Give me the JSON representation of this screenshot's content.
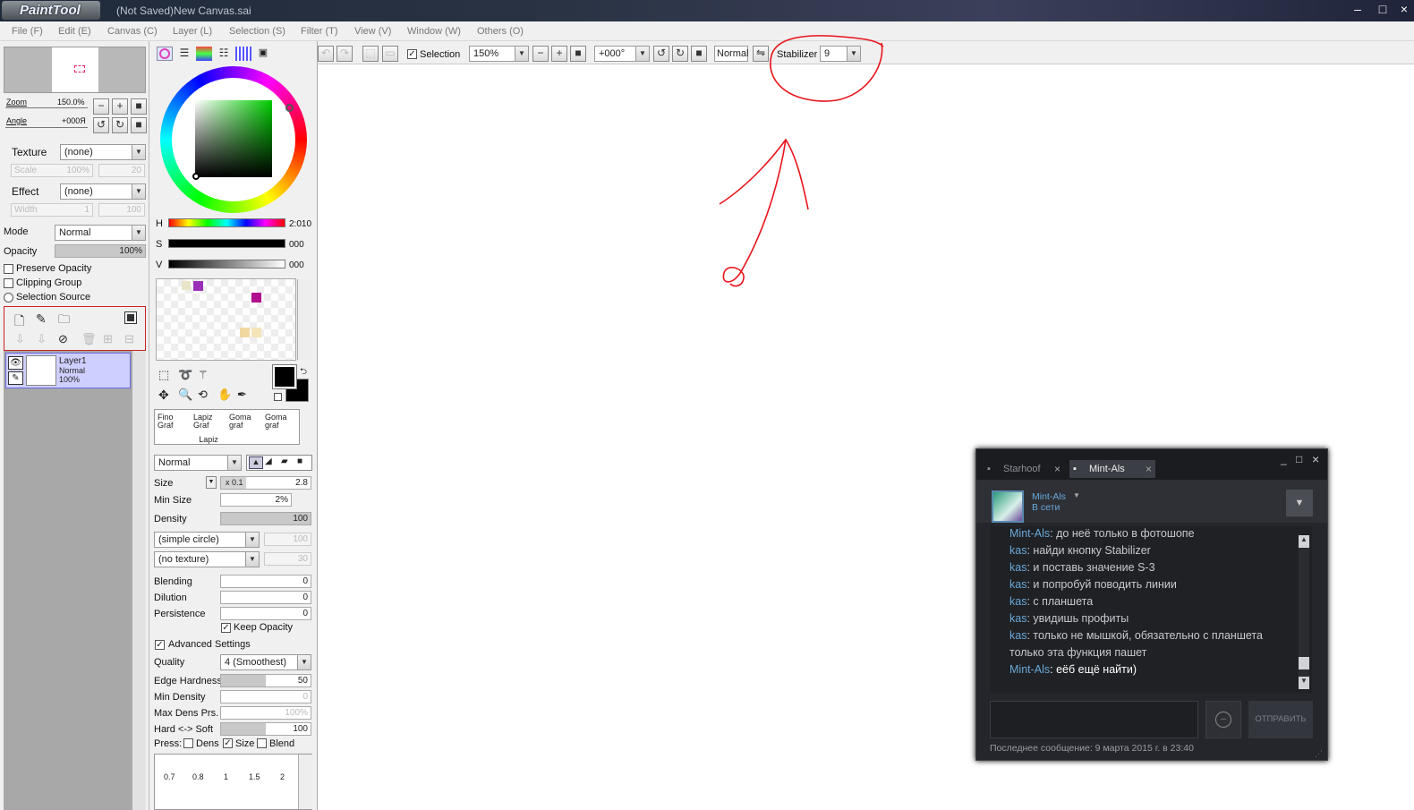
{
  "window": {
    "app_name": "PaintTool SAI",
    "title": "(Not Saved)New Canvas.sai"
  },
  "menu": [
    "File (F)",
    "Edit (E)",
    "Canvas (C)",
    "Layer (L)",
    "Selection (S)",
    "Filter (T)",
    "View (V)",
    "Window (W)",
    "Others (O)"
  ],
  "navigator": {
    "zoom_label": "Zoom",
    "zoom_value": "150.0%",
    "angle_label": "Angle",
    "angle_value": "+000Я"
  },
  "layer_props": {
    "texture_label": "Texture",
    "texture_value": "(none)",
    "scale_label": "Scale",
    "scale_value": "100%",
    "scale_num": "20",
    "effect_label": "Effect",
    "effect_value": "(none)",
    "width_label": "Width",
    "width_value": "1",
    "width_num": "100",
    "mode_label": "Mode",
    "mode_value": "Normal",
    "opacity_label": "Opacity",
    "opacity_value": "100%",
    "preserve_opacity": "Preserve Opacity",
    "clipping_group": "Clipping Group",
    "selection_source": "Selection Source"
  },
  "layer": {
    "name": "Layer1",
    "mode": "Normal",
    "opacity": "100%"
  },
  "color": {
    "h_label": "H",
    "h_value": "2:010",
    "s_label": "S",
    "s_value": "000",
    "v_label": "V",
    "v_value": "000"
  },
  "swatches": [
    "#e8e4c8",
    "#9a2fb8",
    "#b0108e",
    "#f0d8a0",
    "#f4e4b8"
  ],
  "brushes": [
    {
      "name": "Fino Graf",
      "sub": ""
    },
    {
      "name": "Lapiz Graf",
      "sub": "Lapiz"
    },
    {
      "name": "Goma graf",
      "sub": ""
    },
    {
      "name": "Goma graf",
      "sub": ""
    }
  ],
  "tool": {
    "blend_mode": "Normal",
    "size_label": "Size",
    "size_mult": "x 0.1",
    "size_value": "2.8",
    "min_size_label": "Min Size",
    "min_size_value": "2%",
    "density_label": "Density",
    "density_value": "100",
    "shape_value": "(simple circle)",
    "shape_num": "100",
    "texture_value": "(no texture)",
    "texture_num": "30",
    "blending_label": "Blending",
    "blending_value": "0",
    "dilution_label": "Dilution",
    "dilution_value": "0",
    "persistence_label": "Persistence",
    "persistence_value": "0",
    "keep_opacity": "Keep Opacity",
    "advanced": "Advanced Settings",
    "quality_label": "Quality",
    "quality_value": "4 (Smoothest)",
    "edge_label": "Edge Hardness",
    "edge_value": "50",
    "min_density_label": "Min Density",
    "min_density_value": "0",
    "max_dens_label": "Max Dens Prs.",
    "max_dens_value": "100%",
    "hard_soft_label": "Hard <-> Soft",
    "hard_soft_value": "100",
    "press_label": "Press:",
    "press_dens": "Dens",
    "press_size": "Size",
    "press_blend": "Blend",
    "presets": [
      "0.7",
      "0.8",
      "1",
      "1.5",
      "2"
    ]
  },
  "toolbar": {
    "selection_label": "Selection",
    "zoom_value": "150%",
    "angle_value": "+000°",
    "blend_value": "Normal",
    "stabilizer_label": "Stabilizer",
    "stabilizer_value": "9"
  },
  "annotation": {
    "color": "#e8141c"
  },
  "chat": {
    "tabs": [
      "Starhoof",
      "Mint-Als"
    ],
    "friend_name": "Mint-Als",
    "friend_status": "В сети",
    "send_label": "ОТПРАВИТЬ",
    "last_message": "Последнее сообщение: 9 марта 2015 г. в 23:40",
    "messages": [
      {
        "name": "Mint-Als",
        "text": ": до неё только в фотошопе"
      },
      {
        "name": "kas",
        "text": ": найди кнопку Stabilizer"
      },
      {
        "name": "kas",
        "text": ": и поставь значение S-3"
      },
      {
        "name": "kas",
        "text": ": и попробуй поводить линии"
      },
      {
        "name": "kas",
        "text": ": с планшета"
      },
      {
        "name": "kas",
        "text": ": увидишь профиты"
      },
      {
        "name": "kas",
        "text": ": только не мышкой, обязательно с планшета"
      },
      {
        "name": "",
        "text": "только эта функция пашет"
      },
      {
        "name": "Mint-Als",
        "text": ": еёб ещё найти)"
      }
    ]
  }
}
